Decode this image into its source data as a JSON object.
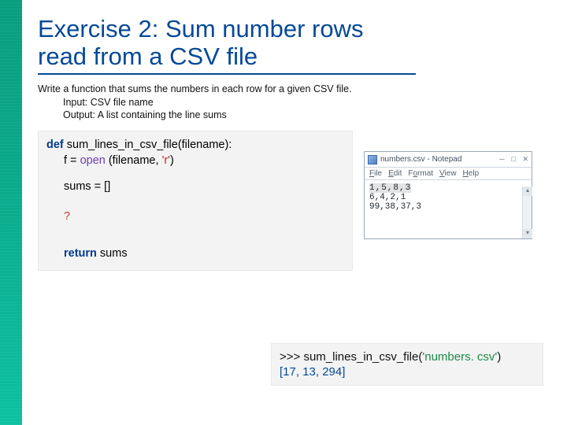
{
  "title_line1": "Exercise 2: Sum number rows",
  "title_line2": "read from a CSV file",
  "desc_main": "Write a function that sums the numbers in each row for a given CSV file.",
  "desc_input": "Input: CSV file name",
  "desc_output": "Output:  A list containing the line sums",
  "code": {
    "kw_def": "def",
    "fn_sig": " sum_lines_in_csv_file(filename):",
    "f_eq": "f = ",
    "open": "open",
    "open_args_a": " (filename, ",
    "open_args_str": "'r'",
    "open_args_b": ")",
    "sums_init": "sums = []",
    "placeholder": "?",
    "kw_return": "return",
    "return_tail": " sums"
  },
  "notepad": {
    "title": "numbers.csv - Notepad",
    "menu": {
      "file": "File",
      "edit": "Edit",
      "format": "Format",
      "view": "View",
      "help": "Help"
    },
    "line1": "1,5,8,3",
    "line2": "6,4,2,1",
    "line3": "99,38,37,3",
    "btns": {
      "min": "─",
      "max": "□",
      "close": "✕"
    }
  },
  "shell": {
    "prompt": ">>> ",
    "call_a": "sum_lines_in_csv_file(",
    "call_str": "'numbers. csv'",
    "call_b": ")",
    "result": "[17, 13, 294]"
  }
}
